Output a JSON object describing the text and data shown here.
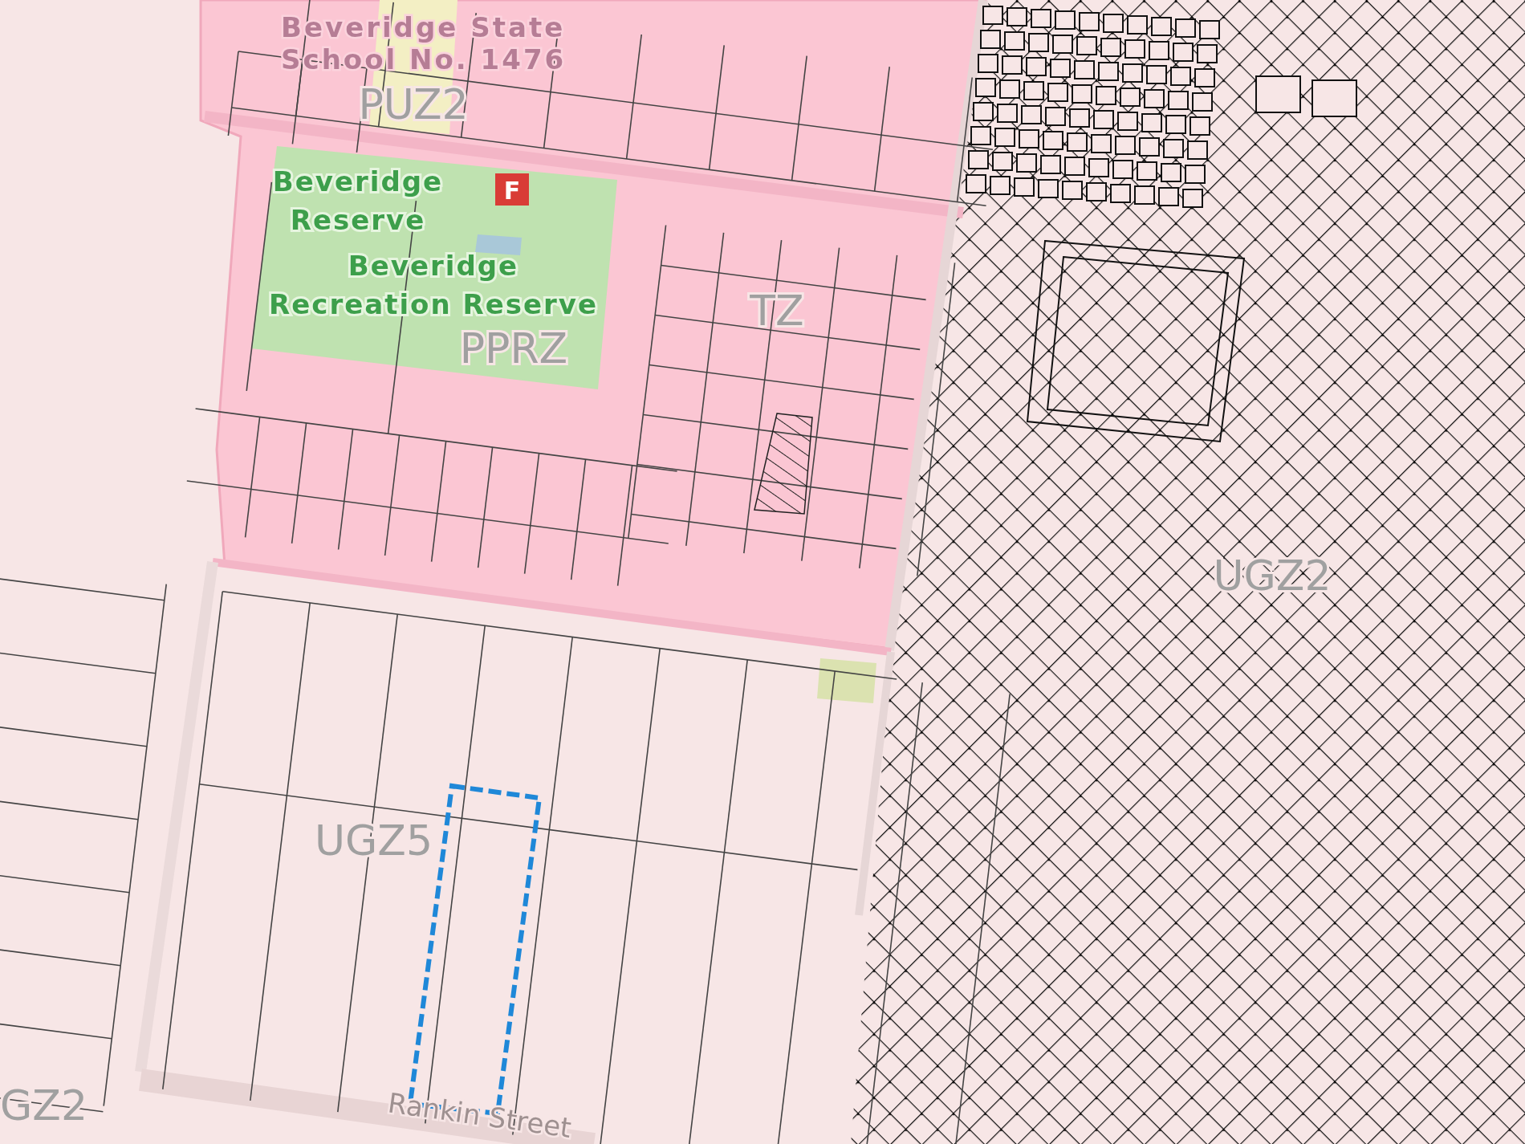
{
  "map": {
    "labels": [
      {
        "kind": "school",
        "lines": [
          "Beveridge State",
          "School No. 1476"
        ]
      },
      {
        "kind": "zone",
        "lines": [
          "PUZ2"
        ]
      },
      {
        "kind": "place",
        "lines": [
          "Beveridge",
          "Reserve"
        ]
      },
      {
        "kind": "place",
        "lines": [
          "Beveridge",
          "Recreation Reserve"
        ]
      },
      {
        "kind": "zone",
        "lines": [
          "PPRZ"
        ]
      },
      {
        "kind": "zone",
        "lines": [
          "TZ"
        ]
      },
      {
        "kind": "zone",
        "lines": [
          "UGZ2"
        ]
      },
      {
        "kind": "zone",
        "lines": [
          "UGZ5"
        ]
      },
      {
        "kind": "street",
        "lines": [
          "Rankin Street"
        ]
      },
      {
        "kind": "zone",
        "lines": [
          "GZ2"
        ]
      }
    ],
    "facility_marker": {
      "text": "F"
    },
    "selected_parcel": {
      "selected": true
    }
  }
}
